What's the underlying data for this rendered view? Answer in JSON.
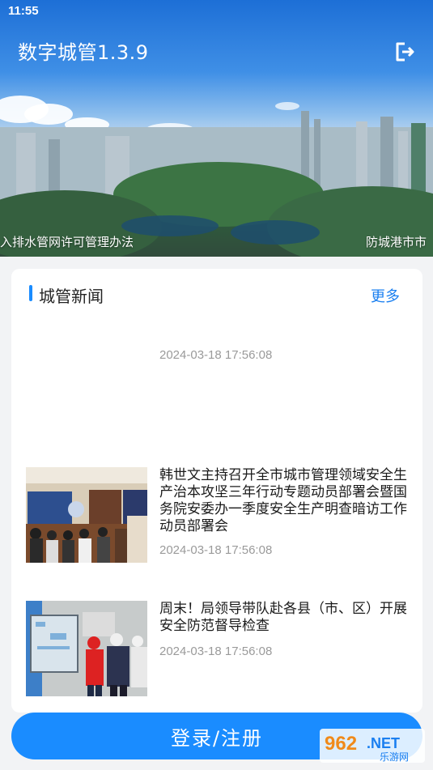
{
  "status_bar": {
    "time": "11:55"
  },
  "header": {
    "title": "数字城管1.3.9",
    "logout_icon": "logout-icon"
  },
  "banner": {
    "ticker_left": "入排水管网许可管理办法",
    "ticker_right": "防城港市市"
  },
  "news": {
    "section_title": "城管新闻",
    "more_label": "更多",
    "items": [
      {
        "title": "",
        "time": "2024-03-18 17:56:08"
      },
      {
        "title": "韩世文主持召开全市城市管理领域安全生产治本攻坚三年行动专题动员部署会暨国务院安委办一季度安全生产明查暗访工作动员部署会",
        "time": "2024-03-18 17:56:08"
      },
      {
        "title": "周末！局领导带队赴各县（市、区）开展安全防范督导检查",
        "time": "2024-03-18 17:56:08"
      }
    ]
  },
  "login": {
    "label": "登录/注册"
  },
  "watermark": {
    "brand": "962",
    "suffix": ".NET",
    "sub": "乐游网"
  },
  "colors": {
    "accent": "#1a8cff",
    "muted": "#9a9a9a"
  }
}
